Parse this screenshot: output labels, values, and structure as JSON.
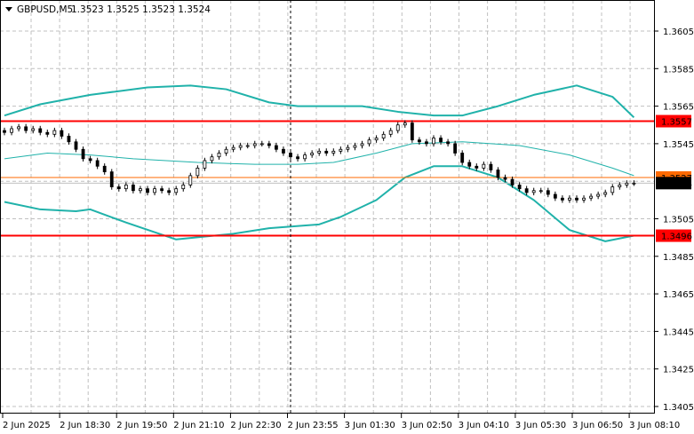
{
  "header": {
    "symbol": "GBPUSD,M5",
    "ohlc": "1.3523 1.3525 1.3523 1.3524",
    "menu_icon": "triangle-down-icon"
  },
  "colors": {
    "band": "#20b2aa",
    "level": "#ff0000",
    "orange_level": "#ff6a00",
    "current_price_bg": "#000000",
    "grid": "#c0c0c0"
  },
  "chart_data": {
    "type": "candlestick",
    "title": "GBPUSD,M5",
    "ylim": [
      1.3395,
      1.362
    ],
    "price_labels": [
      "1.3605",
      "1.3585",
      "1.3565",
      "1.3545",
      "1.3505",
      "1.3485",
      "1.3465",
      "1.3445",
      "1.3425",
      "1.3405"
    ],
    "grid_levels": [
      1.3605,
      1.3585,
      1.3565,
      1.3545,
      1.3525,
      1.3505,
      1.3485,
      1.3465,
      1.3445,
      1.3425,
      1.3405
    ],
    "time_labels": [
      "2 Jun 2025",
      "2 Jun 18:30",
      "2 Jun 19:50",
      "2 Jun 21:10",
      "2 Jun 22:30",
      "2 Jun 23:55",
      "3 Jun 01:30",
      "3 Jun 02:50",
      "3 Jun 04:10",
      "3 Jun 05:30",
      "3 Jun 06:50",
      "3 Jun 08:10"
    ],
    "closes": [
      1.3551,
      1.3553,
      1.3554,
      1.3552,
      1.3553,
      1.3551,
      1.355,
      1.3552,
      1.3549,
      1.3546,
      1.3542,
      1.3537,
      1.3536,
      1.3533,
      1.353,
      1.3522,
      1.3521,
      1.3523,
      1.352,
      1.3521,
      1.3519,
      1.3521,
      1.352,
      1.3519,
      1.3521,
      1.3523,
      1.3528,
      1.3532,
      1.3536,
      1.3538,
      1.354,
      1.3542,
      1.3543,
      1.3544,
      1.3544,
      1.3545,
      1.3545,
      1.3544,
      1.3542,
      1.354,
      1.3538,
      1.3537,
      1.3539,
      1.354,
      1.3541,
      1.354,
      1.3541,
      1.3542,
      1.3543,
      1.3544,
      1.3545,
      1.3547,
      1.3548,
      1.355,
      1.3552,
      1.3555,
      1.3556,
      1.3547,
      1.3546,
      1.3545,
      1.3548,
      1.3546,
      1.3545,
      1.354,
      1.3535,
      1.3533,
      1.3532,
      1.3534,
      1.3531,
      1.3527,
      1.3526,
      1.3523,
      1.3521,
      1.3519,
      1.352,
      1.352,
      1.3518,
      1.3516,
      1.3515,
      1.3516,
      1.3515,
      1.3516,
      1.3517,
      1.3518,
      1.3519,
      1.3522,
      1.3523,
      1.3524,
      1.3524
    ],
    "bollinger": {
      "upper": [
        [
          0,
          1.356
        ],
        [
          5,
          1.3566
        ],
        [
          12,
          1.3571
        ],
        [
          20,
          1.3575
        ],
        [
          26,
          1.3576
        ],
        [
          31,
          1.3574
        ],
        [
          37,
          1.3567
        ],
        [
          41,
          1.3565
        ],
        [
          50,
          1.3565
        ],
        [
          55,
          1.3562
        ],
        [
          60,
          1.356
        ],
        [
          64,
          1.356
        ],
        [
          69,
          1.3565
        ],
        [
          74,
          1.3571
        ],
        [
          80,
          1.3576
        ],
        [
          85,
          1.357
        ],
        [
          88,
          1.3559
        ]
      ],
      "middle": [
        [
          0,
          1.3537
        ],
        [
          6,
          1.354
        ],
        [
          12,
          1.3539
        ],
        [
          18,
          1.3537
        ],
        [
          27,
          1.3535
        ],
        [
          35,
          1.3534
        ],
        [
          41,
          1.3534
        ],
        [
          46,
          1.3535
        ],
        [
          52,
          1.354
        ],
        [
          57,
          1.3545
        ],
        [
          64,
          1.3546
        ],
        [
          72,
          1.3544
        ],
        [
          79,
          1.3539
        ],
        [
          85,
          1.3532
        ],
        [
          88,
          1.3528
        ]
      ],
      "lower": [
        [
          0,
          1.3514
        ],
        [
          5,
          1.351
        ],
        [
          10,
          1.3509
        ],
        [
          12,
          1.351
        ],
        [
          17,
          1.3503
        ],
        [
          24,
          1.3494
        ],
        [
          32,
          1.3497
        ],
        [
          37,
          1.35
        ],
        [
          44,
          1.3502
        ],
        [
          47,
          1.3506
        ],
        [
          52,
          1.3515
        ],
        [
          56,
          1.3527
        ],
        [
          60,
          1.3533
        ],
        [
          64,
          1.3533
        ],
        [
          69,
          1.3527
        ],
        [
          74,
          1.3515
        ],
        [
          79,
          1.3499
        ],
        [
          84,
          1.3493
        ],
        [
          88,
          1.3496
        ]
      ]
    },
    "levels": [
      {
        "name": "resistance",
        "price": 1.3557,
        "label": "1.3557",
        "color": "#ff0000"
      },
      {
        "name": "support",
        "price": 1.3496,
        "label": "1.3496",
        "color": "#ff0000"
      },
      {
        "name": "orange-level",
        "price": 1.3527,
        "label": "1.3527",
        "color": "#ff6a00"
      }
    ],
    "current_price": {
      "price": 1.3524,
      "label": "1.3524"
    },
    "period_separator_label": "2 Jun 23:55"
  }
}
